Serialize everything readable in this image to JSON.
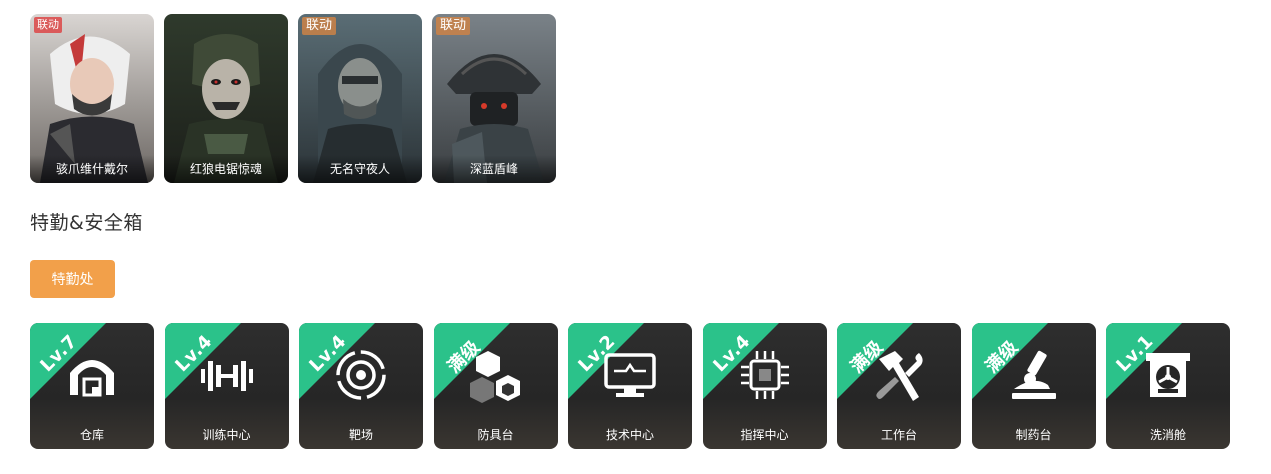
{
  "skins": [
    {
      "name": "骇爪维什戴尔",
      "tag": "联动",
      "tag_style": "red",
      "icon": "operator-portrait-white-hair"
    },
    {
      "name": "红狼电锯惊魂",
      "tag": "",
      "tag_style": "",
      "icon": "operator-portrait-saw-mask"
    },
    {
      "name": "无名守夜人",
      "tag": "联动",
      "tag_style": "orange",
      "icon": "operator-portrait-hooded-soldier"
    },
    {
      "name": "深蓝盾峰",
      "tag": "联动",
      "tag_style": "orange",
      "icon": "operator-portrait-samurai-helmet"
    }
  ],
  "section_title": "特勤&安全箱",
  "dept_button": "特勤处",
  "facilities": [
    {
      "level": "Lv.7",
      "name": "仓库",
      "icon": "warehouse-icon"
    },
    {
      "level": "Lv.4",
      "name": "训练中心",
      "icon": "dumbbell-icon"
    },
    {
      "level": "Lv.4",
      "name": "靶场",
      "icon": "target-icon"
    },
    {
      "level": "满级",
      "name": "防具台",
      "icon": "armor-blocks-icon"
    },
    {
      "level": "Lv.2",
      "name": "技术中心",
      "icon": "monitor-icon"
    },
    {
      "level": "Lv.4",
      "name": "指挥中心",
      "icon": "chip-icon"
    },
    {
      "level": "满级",
      "name": "工作台",
      "icon": "hammer-wrench-icon"
    },
    {
      "level": "满级",
      "name": "制药台",
      "icon": "microscope-icon"
    },
    {
      "level": "Lv.1",
      "name": "洗消舱",
      "icon": "decon-chamber-icon"
    }
  ],
  "colors": {
    "accent_orange": "#f2a04a",
    "level_green": "#2bc28a",
    "card_dark": "#262626"
  }
}
